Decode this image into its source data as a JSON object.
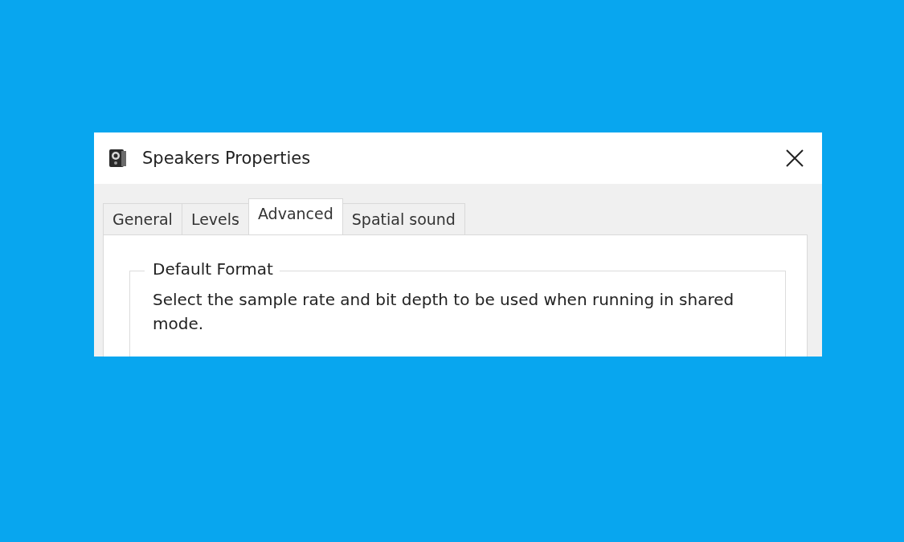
{
  "window": {
    "title": "Speakers Properties"
  },
  "tabs": [
    {
      "label": "General",
      "selected": false
    },
    {
      "label": "Levels",
      "selected": false
    },
    {
      "label": "Advanced",
      "selected": true
    },
    {
      "label": "Spatial sound",
      "selected": false
    }
  ],
  "group": {
    "title": "Default Format",
    "description": "Select the sample rate and bit depth to be used when running in shared mode."
  }
}
